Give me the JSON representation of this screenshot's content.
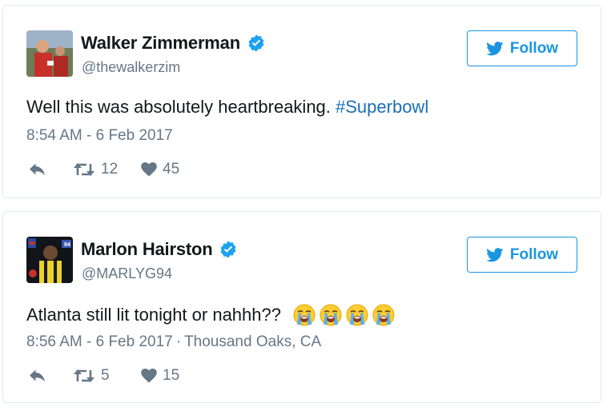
{
  "tweets": [
    {
      "name": "Walker Zimmerman",
      "handle": "@thewalkerzim",
      "follow_label": "Follow",
      "text_plain": "Well this was absolutely heartbreaking. ",
      "hashtag": "#Superbowl",
      "timestamp": "8:54 AM - 6 Feb 2017",
      "location": "",
      "retweets": "12",
      "likes": "45",
      "verified": true
    },
    {
      "name": "Marlon Hairston",
      "handle": "@MARLYG94",
      "follow_label": "Follow",
      "text_plain": "Atlanta still lit tonight or nahhh?? ",
      "hashtag": "",
      "emoji": "😭😭😭😭",
      "emoji_count": 4,
      "timestamp": "8:56 AM - 6 Feb 2017",
      "location_sep": "·",
      "location": "Thousand Oaks, CA",
      "retweets": "5",
      "likes": "15",
      "verified": true
    }
  ],
  "colors": {
    "accent": "#1b95e0",
    "hashtag": "#1b6fb5",
    "muted": "#657786",
    "border": "#e1e8ed",
    "text": "#14171a"
  },
  "icons": [
    "verified-badge-icon",
    "twitter-bird-icon",
    "reply-icon",
    "retweet-icon",
    "heart-icon",
    "loudly-crying-face-icon"
  ]
}
